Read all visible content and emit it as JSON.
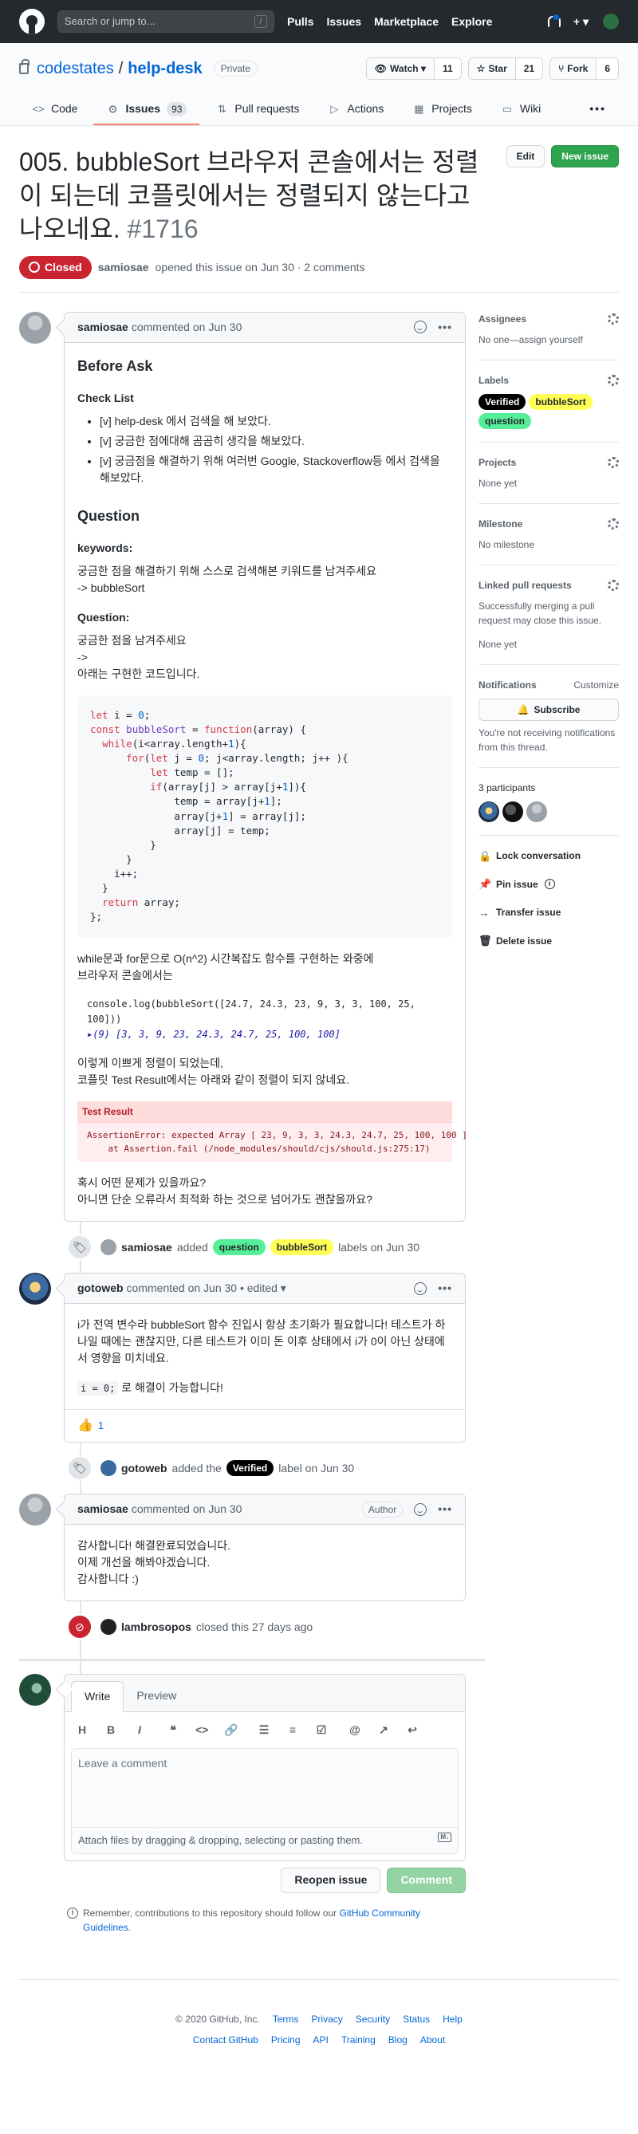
{
  "header": {
    "search_placeholder": "Search or jump to...",
    "slash": "/",
    "nav": [
      "Pulls",
      "Issues",
      "Marketplace",
      "Explore"
    ],
    "plus": "+ ▾"
  },
  "repo": {
    "owner": "codestates",
    "sep": "/",
    "name": "help-desk",
    "visibility": "Private",
    "watch_label": "Watch ▾",
    "watch_count": "11",
    "star_label": "Star",
    "star_count": "21",
    "fork_label": "Fork",
    "fork_count": "6",
    "tabs": [
      {
        "label": "Code",
        "icon": "code-icon"
      },
      {
        "label": "Issues",
        "icon": "issue-icon",
        "count": "93"
      },
      {
        "label": "Pull requests",
        "icon": "pull-request-icon"
      },
      {
        "label": "Actions",
        "icon": "play-icon"
      },
      {
        "label": "Projects",
        "icon": "project-icon"
      },
      {
        "label": "Wiki",
        "icon": "book-icon"
      }
    ],
    "more": "•••"
  },
  "issue": {
    "title": "005. bubbleSort 브라우저 콘솔에서는 정렬이 되는데 코플릿에서는 정렬되지 않는다고 나오네요.",
    "number": "#1716",
    "edit_label": "Edit",
    "new_issue_label": "New issue",
    "state": "Closed",
    "author": "samiosae",
    "meta": "opened this issue on Jun 30 · 2 comments"
  },
  "comments": [
    {
      "author": "samiosae",
      "meta": "commented on Jun 30",
      "h_before": "Before Ask",
      "h_check": "Check List",
      "checklist": [
        "[v] help-desk 에서 검색을 해 보았다.",
        "[v] 궁금한 점에대해 곰곰히 생각을 해보았다.",
        "[v] 궁금점을 해결하기 위해 여러번 Google, Stackoverflow등 에서 검색을 해보았다."
      ],
      "h_question": "Question",
      "h_keywords": "keywords:",
      "keywords_text1": "궁금한 점을 해결하기 위해 스스로 검색해본 키워드를 남겨주세요",
      "keywords_text2": "-> bubbleSort",
      "h_question2": "Question:",
      "q_text1": "궁금한 점을 남겨주세요",
      "q_text2": "->",
      "q_text3": "아래는 구현한 코드입니다.",
      "p_while1": "while문과 for문으로 O(n^2) 시간복잡도 함수를 구현하는 와중에",
      "p_while2": "브라우저 콘솔에서는",
      "console_in": "console.log(bubbleSort([24.7, 24.3, 23, 9, 3, 3, 100, 25, 100]))",
      "console_out": "▸(9) [3, 3, 9, 23, 24.3, 24.7, 25, 100, 100]",
      "p_sorted1": "이렇게 이쁘게 정렬이 되었는데,",
      "p_sorted2": "코플릿 Test Result에서는 아래와 같이 정렬이 되지 않네요.",
      "test_header": "Test Result",
      "test_line1": "AssertionError: expected Array [ 23, 9, 3, 3, 24.3, 24.7, 25, 100, 100 ]",
      "test_line2": "    at Assertion.fail (/node_modules/should/cjs/should.js:275:17)",
      "p_end1": "혹시 어떤 문제가 있을까요?",
      "p_end2": "아니면 단순 오류라서 최적화 하는 것으로 넘어가도 괜찮을까요?"
    },
    {
      "author": "gotoweb",
      "meta": "commented on Jun 30 • edited ▾",
      "text1": "i가 전역 변수라 bubbleSort 함수 진입시 항상 초기화가 필요합니다! 테스트가 하나일 때에는 괜찮지만, 다른 테스트가 이미 돈 이후 상태에서 i가 0이 아닌 상태에서 영향을 미치네요.",
      "code": "i = 0;",
      "text2": "로 해결이 가능합니다!",
      "reaction": "👍",
      "reaction_count": "1"
    },
    {
      "author": "samiosae",
      "meta": "commented on Jun 30",
      "badge": "Author",
      "lines": [
        "감사합니다! 해결완료되었습니다.",
        "이제 개선을 해봐야겠습니다.",
        "감사합니다 :)"
      ]
    }
  ],
  "events": {
    "labels_added": {
      "actor": "samiosae",
      "verb": "added",
      "l1": "question",
      "l2": "bubbleSort",
      "tail": "labels on Jun 30"
    },
    "verified_added": {
      "actor": "gotoweb",
      "verb": "added the",
      "l1": "Verified",
      "tail": "label on Jun 30"
    },
    "closed": {
      "actor": "lambrosopos",
      "tail": "closed this 27 days ago"
    }
  },
  "new_comment": {
    "tab_write": "Write",
    "tab_preview": "Preview",
    "placeholder": "Leave a comment",
    "attach": "Attach files by dragging & dropping, selecting or pasting them.",
    "md": "M↓",
    "reopen": "Reopen issue",
    "submit": "Comment",
    "remember_pre": "Remember, contributions to this repository should follow our",
    "remember_link": "GitHub Community Guidelines",
    "remember_post": "."
  },
  "sidebar": {
    "assignees_h": "Assignees",
    "assignees_v": "No one—assign yourself",
    "labels_h": "Labels",
    "labels": [
      {
        "name": "Verified",
        "bg": "#000000",
        "fg": "#ffffff"
      },
      {
        "name": "bubbleSort",
        "bg": "#ffff55",
        "fg": "#24292e"
      },
      {
        "name": "question",
        "bg": "#55ee99",
        "fg": "#24292e"
      }
    ],
    "projects_h": "Projects",
    "projects_v": "None yet",
    "milestone_h": "Milestone",
    "milestone_v": "No milestone",
    "linked_h": "Linked pull requests",
    "linked_v": "Successfully merging a pull request may close this issue.",
    "linked_none": "None yet",
    "notif_h": "Notifications",
    "notif_customize": "Customize",
    "subscribe": "Subscribe",
    "notif_v": "You're not receiving notifications from this thread.",
    "participants": "3 participants",
    "lock": "Lock conversation",
    "pin": "Pin issue",
    "transfer": "Transfer issue",
    "delete": "Delete issue"
  },
  "footer": {
    "copy": "© 2020 GitHub, Inc.",
    "row1": [
      "Terms",
      "Privacy",
      "Security",
      "Status",
      "Help"
    ],
    "row2": [
      "Contact GitHub",
      "Pricing",
      "API",
      "Training",
      "Blog",
      "About"
    ]
  },
  "colors": {
    "accent": "#0366d6",
    "closed": "#cb2431",
    "green": "#2ea44f"
  }
}
